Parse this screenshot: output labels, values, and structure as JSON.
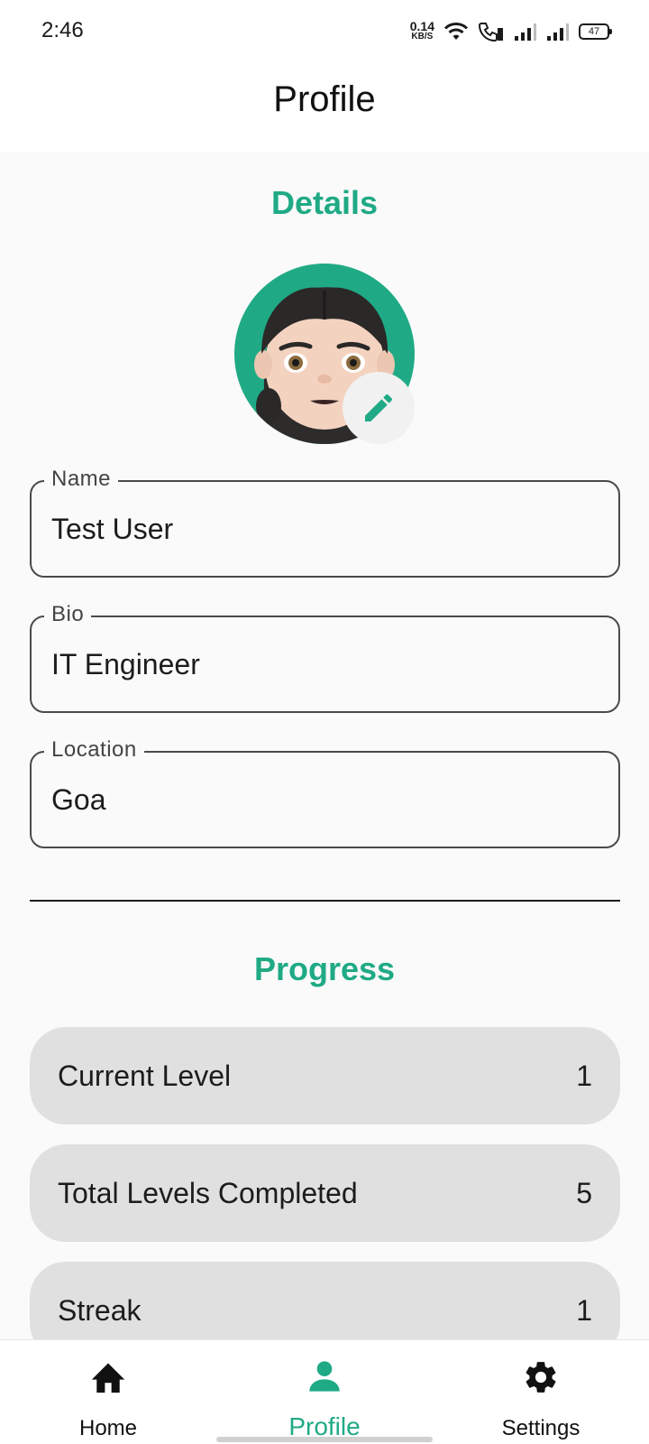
{
  "status_bar": {
    "time": "2:46",
    "net_speed_value": "0.14",
    "net_speed_unit": "KB/S",
    "battery": "47"
  },
  "app_bar": {
    "title": "Profile"
  },
  "details": {
    "title": "Details",
    "fields": [
      {
        "label": "Name",
        "value": "Test User"
      },
      {
        "label": "Bio",
        "value": "IT Engineer"
      },
      {
        "label": "Location",
        "value": "Goa"
      }
    ]
  },
  "progress": {
    "title": "Progress",
    "stats": [
      {
        "label": "Current Level",
        "value": "1"
      },
      {
        "label": "Total Levels Completed",
        "value": "5"
      },
      {
        "label": "Streak",
        "value": "1"
      }
    ]
  },
  "bottom_nav": {
    "items": [
      {
        "label": "Home",
        "icon": "home-icon"
      },
      {
        "label": "Profile",
        "icon": "person-icon",
        "active": true
      },
      {
        "label": "Settings",
        "icon": "gear-icon"
      }
    ]
  },
  "colors": {
    "accent": "#1faa85",
    "row_bg": "#e0e0e0"
  }
}
